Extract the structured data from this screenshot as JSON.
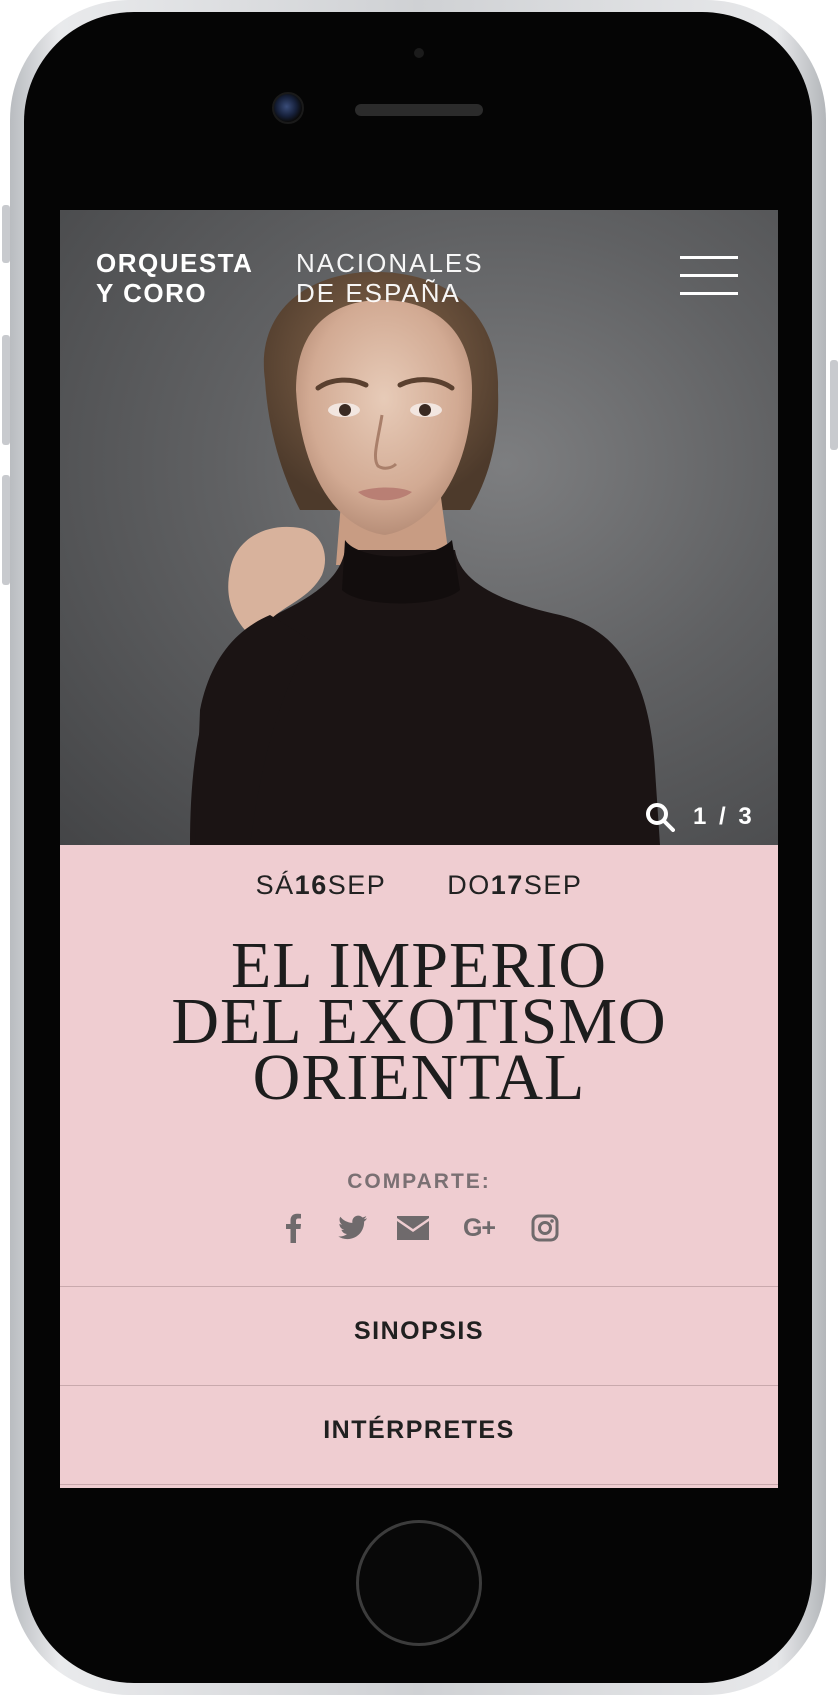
{
  "brand": {
    "line1_bold": "ORQUESTA",
    "line2_bold": "Y CORO",
    "line1_light": "NACIONALES",
    "line2_light": "DE ESPAÑA"
  },
  "slider": {
    "counter": "1 / 3"
  },
  "dates": [
    {
      "weekday": "SÁ",
      "day": "16",
      "month": "SEP"
    },
    {
      "weekday": "DO",
      "day": "17",
      "month": "SEP"
    }
  ],
  "title_lines": [
    "EL IMPERIO",
    "DEL EXOTISMO",
    "ORIENTAL"
  ],
  "share": {
    "label": "COMPARTE:",
    "gplus": "G+",
    "icons": [
      "facebook-icon",
      "twitter-icon",
      "mail-icon",
      "google-plus-icon",
      "instagram-icon"
    ]
  },
  "sections": [
    {
      "label": "SINOPSIS"
    },
    {
      "label": "INTÉRPRETES"
    }
  ],
  "colors": {
    "content_bg": "#efcdd1",
    "hero_bg": "#606163",
    "text": "#1d1d1d",
    "share_icon": "#6f6a6c"
  }
}
